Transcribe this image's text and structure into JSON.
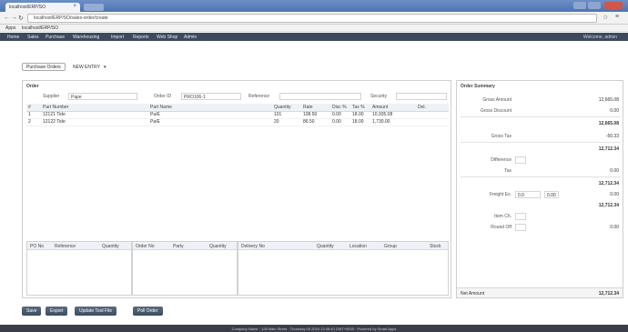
{
  "browser": {
    "tab_title": "localhost/ERP/SO",
    "url": "localhost/ERP/SO/sales-order/create",
    "bookmarks": [
      "Apps",
      "localhost/ERP/SO"
    ]
  },
  "menu": {
    "items": [
      "Home",
      "Sales",
      "Purchase",
      "Warehousing",
      "Import",
      "Reports",
      "Web Shop",
      "Admin"
    ],
    "user": "Welcome, admin"
  },
  "breadcrumb": {
    "button": "Purchase Orders",
    "current": "NEW ENTRY"
  },
  "order": {
    "title": "Order",
    "fields": {
      "supplier_label": "Supplier",
      "supplier_value": "Pape",
      "order_no_label": "Order ID",
      "order_no_value": "PRO106-1",
      "reference_label": "Reference",
      "security_label": "Security"
    },
    "columns": [
      "#",
      "Part Number",
      "Part Name",
      "Quantity",
      "Rate",
      "Disc %",
      "Tax %",
      "Amount",
      "Del."
    ],
    "rows": [
      [
        "1",
        "12121 Tide",
        "Pa/E",
        "101",
        "108.50",
        "0.00",
        "18.00",
        "10,935.08",
        ""
      ],
      [
        "2",
        "12122 Tide",
        "Pa/E",
        "20",
        "86.50",
        "0.00",
        "18.00",
        "1,730.00",
        ""
      ]
    ],
    "lower_a": [
      "PO No",
      "Reference",
      "Quantity"
    ],
    "lower_b": [
      "Order No",
      "Party",
      "Quantity"
    ],
    "lower_c": [
      "Delivery No",
      "Quantity",
      "Location",
      "Group",
      "Stock"
    ]
  },
  "summary": {
    "title": "Order Summary",
    "rows": [
      {
        "label": "Gross Amount",
        "value": "12,665.08"
      },
      {
        "label": "Gross Discount",
        "value": "0.00"
      },
      {
        "label": "",
        "value": "12,665.08"
      },
      {
        "label": "Gross Tax",
        "value": "-50.33"
      },
      {
        "label": "",
        "value": "12,712.34"
      },
      {
        "label": "Difference",
        "value": ""
      },
      {
        "label": "Tax",
        "value": "0.00"
      },
      {
        "label": "",
        "value": "12,712.34"
      },
      {
        "label": "Freight Ex.",
        "box1": "0.0",
        "box2": "0.00",
        "value": "0.00"
      },
      {
        "label": "",
        "value": "12,712.34"
      },
      {
        "label": "Item Ch.",
        "value": ""
      },
      {
        "label": "Round Off",
        "value": "0.00"
      }
    ],
    "net_label": "Net Amount",
    "net_value": "12,712.34"
  },
  "buttons": [
    "Save",
    "Export",
    "Update Tool File",
    "Poll Order"
  ],
  "footer": "Company Name · 128 Main Street · Thursday 05 2024 13:48:40 GMT+0530 · Powered by Smart Apps"
}
